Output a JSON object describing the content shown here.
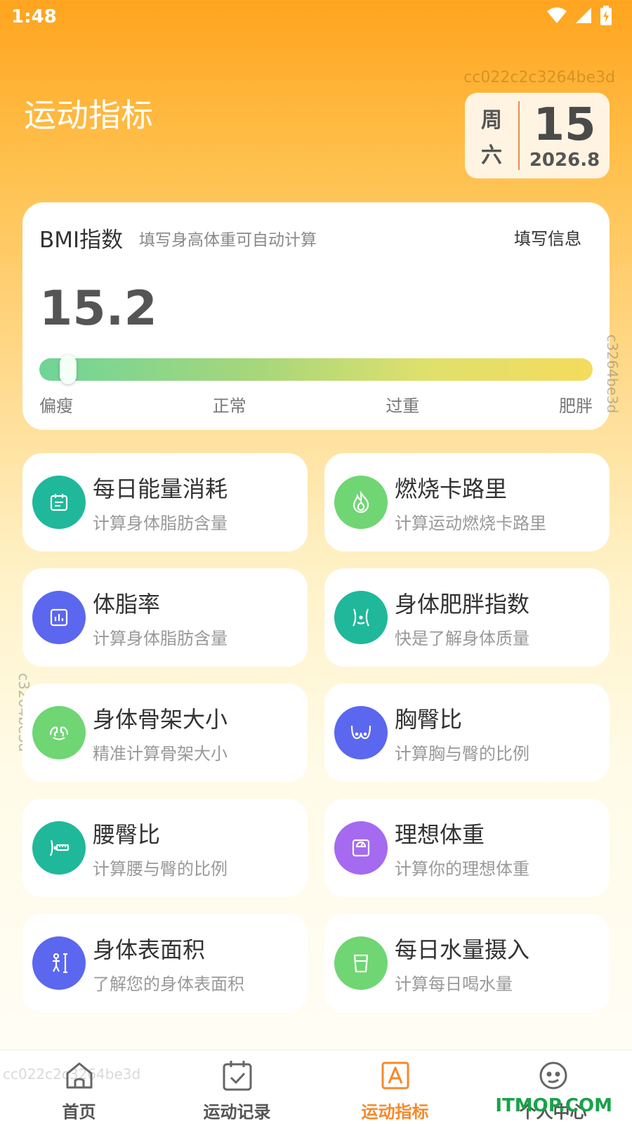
{
  "status_bar": {
    "time": "1:48"
  },
  "watermark": "cc022c2c3264be3d",
  "side_watermark": "c3264be3d",
  "tab_watermark": "cc022c2c3264be3d",
  "page_title": "运动指标",
  "date": {
    "week_1": "周",
    "week_2": "六",
    "day": "15",
    "year_month": "2026.8"
  },
  "bmi": {
    "title": "BMI指数",
    "subtitle": "填写身高体重可自动计算",
    "fill_button": "填写信息",
    "value": "15.2",
    "level_fraction": 0.03,
    "labels": [
      "偏瘦",
      "正常",
      "过重",
      "肥胖"
    ]
  },
  "tools": [
    {
      "title": "每日能量消耗",
      "desc": "计算身体脂肪含量",
      "icon": "calendar-icon",
      "color": "#20b89a"
    },
    {
      "title": "燃烧卡路里",
      "desc": "计算运动燃烧卡路里",
      "icon": "flame-icon",
      "color": "#6fd673"
    },
    {
      "title": "体脂率",
      "desc": "计算身体脂肪含量",
      "icon": "bar-chart-icon",
      "color": "#5b67ef"
    },
    {
      "title": "身体肥胖指数",
      "desc": "快是了解身体质量",
      "icon": "waist-icon",
      "color": "#20b89a"
    },
    {
      "title": "身体骨架大小",
      "desc": "精准计算骨架大小",
      "icon": "muscle-icon",
      "color": "#6fd673"
    },
    {
      "title": "胸臀比",
      "desc": "计算胸与臀的比例",
      "icon": "bust-icon",
      "color": "#5b67ef"
    },
    {
      "title": "腰臀比",
      "desc": "计算腰与臀的比例",
      "icon": "tape-measure-icon",
      "color": "#20b89a"
    },
    {
      "title": "理想体重",
      "desc": "计算你的理想体重",
      "icon": "scale-icon",
      "color": "#a56af0"
    },
    {
      "title": "身体表面积",
      "desc": "了解您的身体表面积",
      "icon": "person-ruler-icon",
      "color": "#5b67ef"
    },
    {
      "title": "每日水量摄入",
      "desc": "计算每日喝水量",
      "icon": "water-cup-icon",
      "color": "#6fd673"
    }
  ],
  "tabs": [
    {
      "label": "首页",
      "icon": "home-icon"
    },
    {
      "label": "运动记录",
      "icon": "checklist-icon"
    },
    {
      "label": "运动指标",
      "icon": "letter-a-icon",
      "active": true
    },
    {
      "label": "个人中心",
      "icon": "face-icon"
    }
  ],
  "site_watermark": "ITMOP.COM",
  "colors": {
    "accent": "#f5892b",
    "header_top": "#ffa41e"
  }
}
